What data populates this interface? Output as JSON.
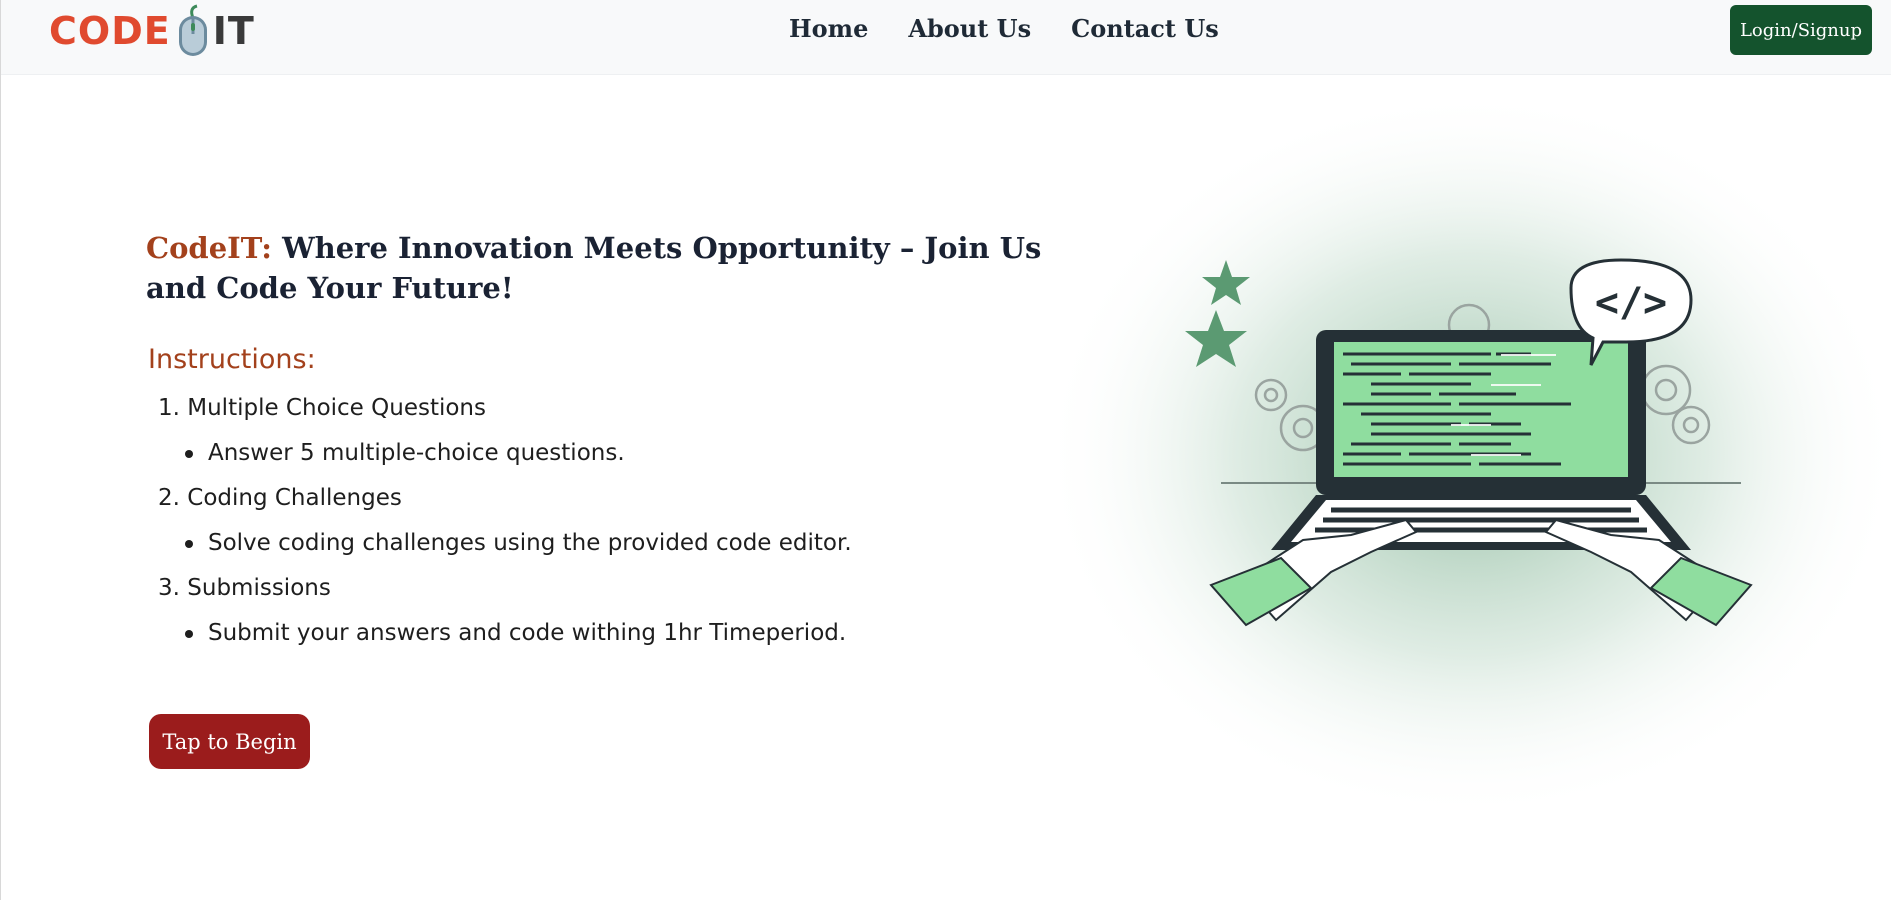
{
  "brand": {
    "logo_text_left": "CODE",
    "logo_text_right": "IT"
  },
  "nav": {
    "links": [
      "Home",
      "About Us",
      "Contact Us"
    ],
    "login_label": "Login/Signup"
  },
  "hero": {
    "title_brand": "CodeIT:",
    "title_rest": " Where Innovation Meets Opportunity – Join Us and Code Your Future!"
  },
  "instructions": {
    "heading": "Instructions:",
    "steps": [
      {
        "number": "1.",
        "title": "Multiple Choice Questions",
        "detail": "Answer 5 multiple-choice questions."
      },
      {
        "number": "2.",
        "title": "Coding Challenges",
        "detail": "Solve coding challenges using the provided code editor."
      },
      {
        "number": "3.",
        "title": "Submissions",
        "detail": "Submit your answers and code withing 1hr Timeperiod."
      }
    ]
  },
  "cta": {
    "begin_label": "Tap to Begin"
  },
  "illustration": {
    "bubble_text": "</>"
  },
  "colors": {
    "brand_red": "#e04a2f",
    "accent_brown": "#a3411c",
    "login_green": "#14532d",
    "begin_red": "#9b1c1c",
    "screen_green": "#8fdd9f"
  }
}
